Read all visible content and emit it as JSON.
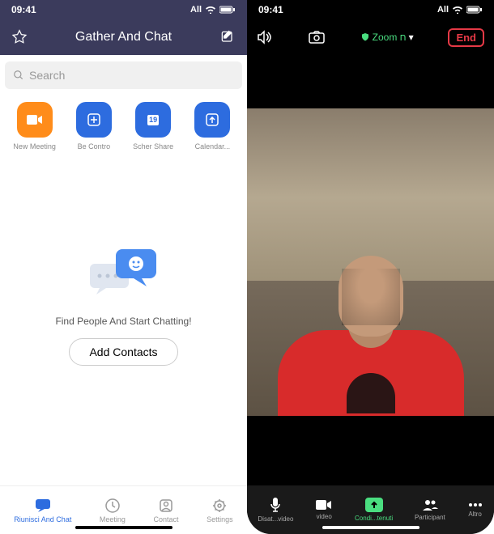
{
  "left": {
    "status": {
      "time": "09:41",
      "carrier": "All"
    },
    "header": {
      "title": "Gather And Chat"
    },
    "search": {
      "placeholder": "Search"
    },
    "actions": [
      {
        "label": "New Meeting",
        "icon": "video"
      },
      {
        "label": "Be Contro",
        "icon": "plus"
      },
      {
        "label": "Scher Share",
        "icon": "calendar",
        "badge": "19"
      },
      {
        "label": "Calendar...",
        "icon": "up"
      }
    ],
    "empty": {
      "text": "Find People And Start Chatting!",
      "button": "Add Contacts"
    },
    "tabs": [
      {
        "label": "Riunisci And Chat"
      },
      {
        "label": "Meeting"
      },
      {
        "label": "Contact"
      },
      {
        "label": "Settings"
      }
    ]
  },
  "right": {
    "status": {
      "time": "09:41",
      "carrier": "All"
    },
    "top": {
      "zoom": "Zoom ח",
      "end": "End"
    },
    "tabs": [
      {
        "label": "Disat...video"
      },
      {
        "label": "video"
      },
      {
        "label": "Condi...tenuti"
      },
      {
        "label": "Participant"
      },
      {
        "label": "Altro"
      }
    ]
  }
}
